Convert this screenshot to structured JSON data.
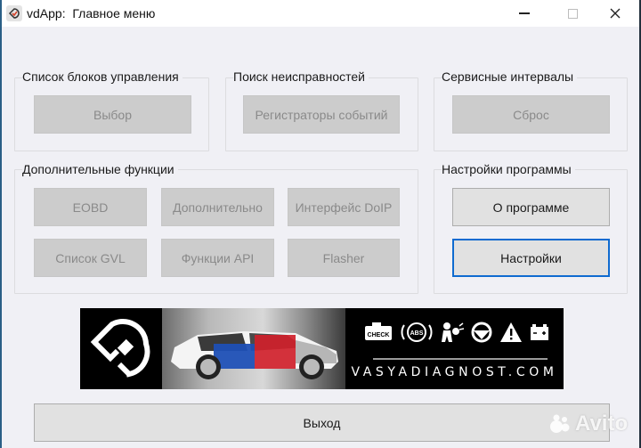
{
  "window": {
    "title": "vdApp:  Главное меню",
    "controls": {
      "minimize": "minimize",
      "maximize": "maximize",
      "close": "close"
    }
  },
  "groups": {
    "control_units": {
      "title": "Список блоков управления",
      "buttons": [
        {
          "label": "Выбор",
          "enabled": false
        }
      ]
    },
    "fault_search": {
      "title": "Поиск неисправностей",
      "buttons": [
        {
          "label": "Регистраторы событий",
          "enabled": false
        }
      ]
    },
    "service_intervals": {
      "title": "Сервисные интервалы",
      "buttons": [
        {
          "label": "Сброс",
          "enabled": false
        }
      ]
    },
    "extra_functions": {
      "title": "Дополнительные функции",
      "buttons": [
        {
          "label": "EOBD",
          "enabled": false
        },
        {
          "label": "Дополнительно",
          "enabled": false
        },
        {
          "label": "Интерфейс DoIP",
          "enabled": false
        },
        {
          "label": "Список GVL",
          "enabled": false
        },
        {
          "label": "Функции API",
          "enabled": false
        },
        {
          "label": "Flasher",
          "enabled": false
        }
      ]
    },
    "program_settings": {
      "title": "Настройки программы",
      "buttons": [
        {
          "label": "О программе",
          "enabled": true
        },
        {
          "label": "Настройки",
          "enabled": true,
          "focused": true
        }
      ]
    }
  },
  "banner": {
    "website": "VASYADIAGNOST.COM",
    "icons": [
      "check-engine-icon",
      "abs-icon",
      "airbag-icon",
      "steering-wheel-icon",
      "warning-triangle-icon",
      "battery-icon"
    ],
    "check_label": "CHECK",
    "abs_label": "ABS"
  },
  "exit_button": {
    "label": "Выход"
  },
  "watermark": {
    "text": "Avito"
  },
  "colors": {
    "focus_border": "#0f6bd0",
    "disabled_bg": "#cccccc",
    "disabled_text": "#8a8a8a"
  }
}
